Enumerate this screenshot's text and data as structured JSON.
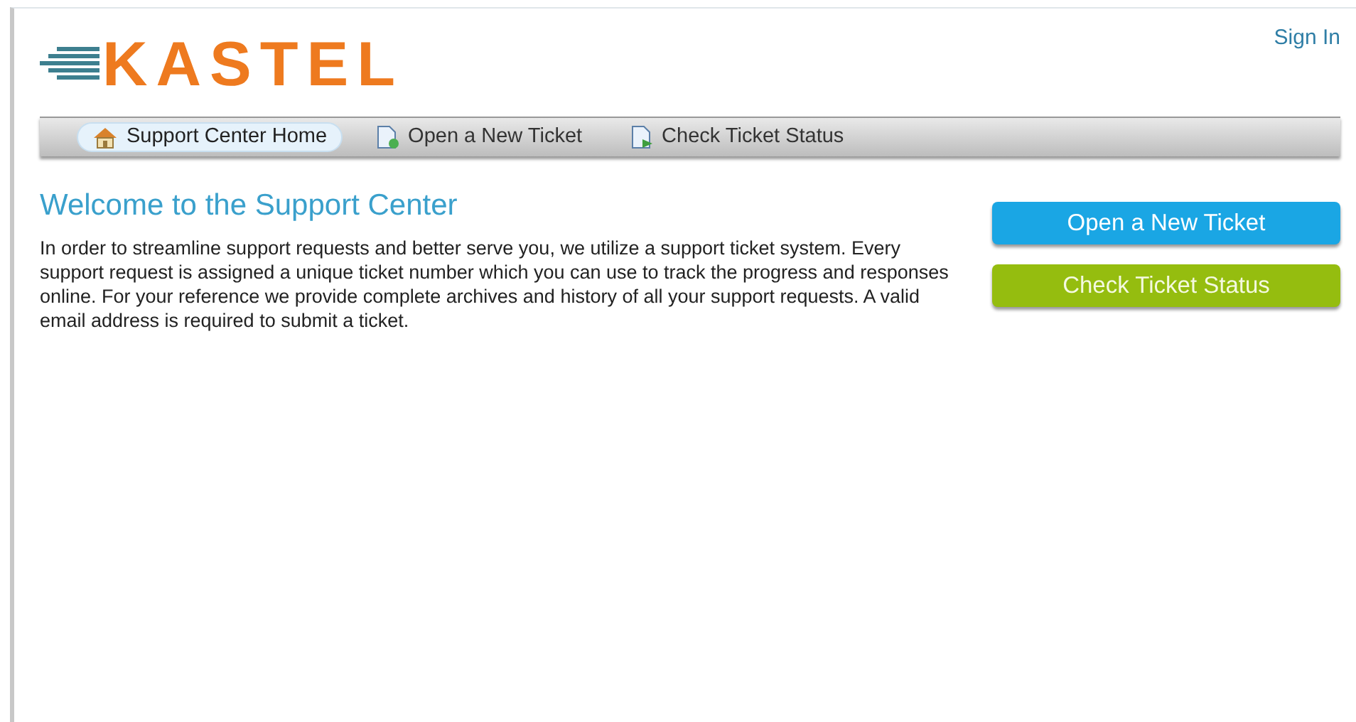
{
  "header": {
    "logo": "KASTEL",
    "sign_in": "Sign In"
  },
  "nav": [
    {
      "label": "Support Center Home",
      "kind": "home",
      "selected": true
    },
    {
      "label": "Open a New Ticket",
      "kind": "new",
      "selected": false
    },
    {
      "label": "Check Ticket Status",
      "kind": "status",
      "selected": false
    }
  ],
  "main": {
    "title": "Welcome to the Support Center",
    "text": "In order to streamline support requests and better serve you, we utilize a support ticket system. Every support request is assigned a unique ticket number which you can use to track the progress and responses online. For your reference we provide complete archives and history of all your support requests. A valid email address is required to submit a ticket."
  },
  "actions": [
    {
      "label": "Open a New Ticket",
      "kind": "new"
    },
    {
      "label": "Check Ticket Status",
      "kind": "status"
    }
  ]
}
